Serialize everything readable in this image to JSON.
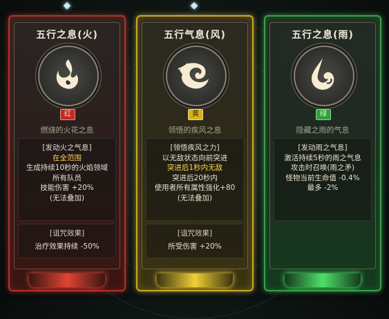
{
  "cards": [
    {
      "title": "五行之息(火)",
      "emblem_icon": "fire-swirl-icon",
      "badge": "红",
      "badge_color": "#c42a22",
      "subtitle": "燃烧的火花之息",
      "desc_lines": [
        "[发动火之气息]",
        "在全范围",
        "生成持续10秒的火焰领域",
        "所有队员",
        "技能伤害 +20%",
        "(无法叠加)"
      ],
      "curse_head": "[诅咒效果]",
      "curse_effect": "治疗效果持续 -50%"
    },
    {
      "title": "五行气息(风)",
      "emblem_icon": "wind-swirl-icon",
      "badge": "黄",
      "badge_color": "#d6b21c",
      "subtitle": "领悟的疾风之息",
      "desc_lines": [
        "[领悟疾风之力]",
        "以无敌状态向前突进",
        "突进后1秒内无敌",
        "突进后20秒内",
        "使用者所有属性强化+80",
        "(无法叠加)"
      ],
      "curse_head": "[诅咒效果]",
      "curse_effect": "所受伤害 +20%"
    },
    {
      "title": "五行之息(雨)",
      "emblem_icon": "rain-drop-swirl-icon",
      "badge": "绿",
      "badge_color": "#2ea23b",
      "subtitle": "隐藏之雨的气息",
      "desc_lines": [
        "[发动雨之气息]",
        "激活持续5秒的雨之气息",
        "攻击时召唤(雨之矛)",
        "怪物当前生命值 -0.4%",
        "最多 -2%"
      ],
      "curse_head": "",
      "curse_effect": ""
    }
  ],
  "top_ornament_icon": "diamond-chevron-icon"
}
